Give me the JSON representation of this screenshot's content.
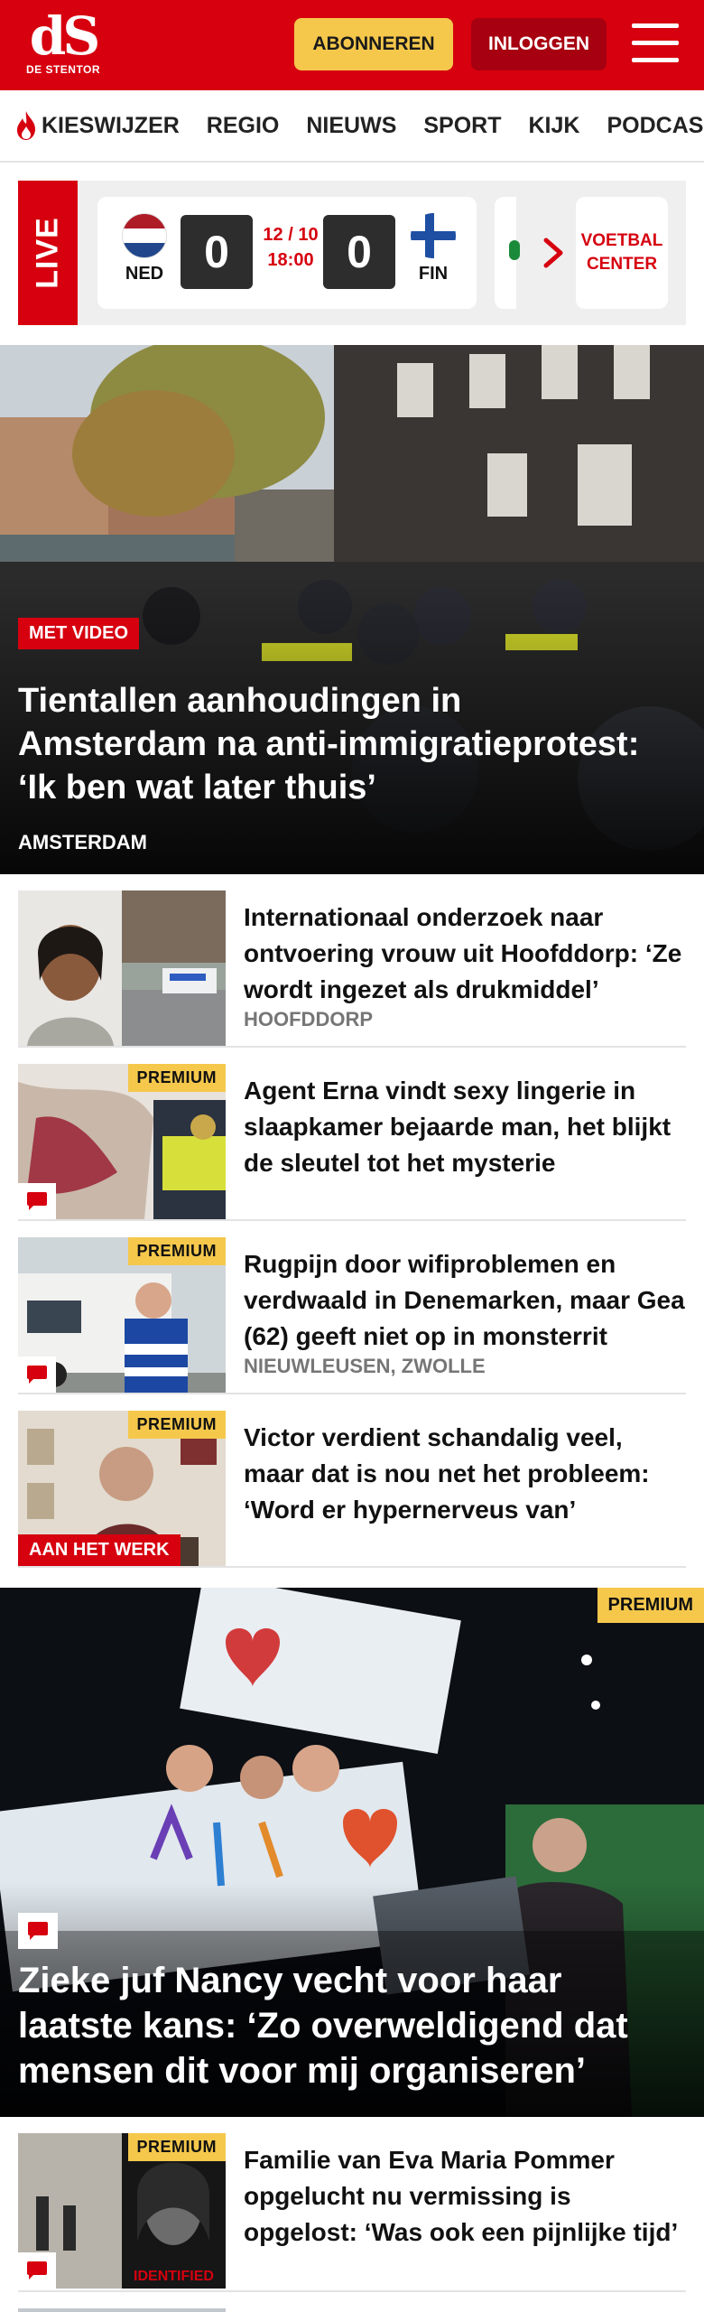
{
  "header": {
    "logo_mark": "dS",
    "logo_sub": "DE STENTOR",
    "subscribe_label": "ABONNEREN",
    "login_label": "INLOGGEN"
  },
  "nav": {
    "items": [
      "KIESWIJZER",
      "REGIO",
      "NIEUWS",
      "SPORT",
      "KIJK",
      "PODCAS"
    ]
  },
  "live": {
    "tag": "LIVE",
    "match": {
      "home": "NED",
      "away": "FIN",
      "home_score": "0",
      "away_score": "0",
      "date": "12 / 10",
      "time": "18:00"
    },
    "voetbal_center": "VOETBAL CENTER"
  },
  "hero": {
    "badge": "MET VIDEO",
    "title": "Tientallen aanhoudingen in Amsterdam na anti-immigratiepro­test: ‘Ik ben wat later thuis’",
    "place": "AMSTERDAM"
  },
  "articles": [
    {
      "title": "Internationaal onderzoek naar ontvoering vrouw uit Hoofddorp: ‘Ze wordt ingezet als drukmiddel’",
      "place": "HOOFDDORP"
    },
    {
      "premium": "PREMIUM",
      "title": "Agent Erna vindt sexy lingerie in slaapkamer bejaarde man, het blijkt de sleutel tot het mysterie",
      "place": ""
    },
    {
      "premium": "PREMIUM",
      "title": "Rugpijn door wifiproblemen en verdwaald in Denemarken, maar Gea (62) geeft niet op in monsterrit",
      "place": "NIEUWLEUSEN, ZWOLLE"
    },
    {
      "premium": "PREMIUM",
      "label": "AAN HET WERK",
      "title": "Victor verdient schandalig veel, maar dat is nou net het probleem: ‘Word er hypernerveus van’",
      "place": ""
    }
  ],
  "big_story": {
    "premium": "PREMIUM",
    "title": "Zieke juf Nancy vecht voor haar laatste kans: ‘Zo overweldigend dat mensen dit voor mij organiseren’"
  },
  "articles2": [
    {
      "premium": "PREMIUM",
      "title": "Familie van Eva Maria Pommer opgelucht nu vermissing is opgelost: ‘Was ook een pijnlijke tijd’",
      "thumb_text": "IDENTIFIED"
    }
  ],
  "colors": {
    "brand_red": "#d6000f",
    "premium_yellow": "#f5c84c",
    "login_dark_red": "#a70010"
  }
}
